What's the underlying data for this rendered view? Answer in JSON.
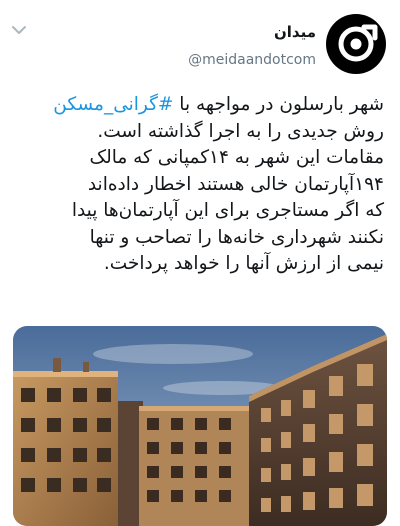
{
  "header": {
    "display_name": "میدان",
    "handle": "@meidaandotcom"
  },
  "tweet": {
    "line1_prefix": "شهر بارسلون در مواجهه با ",
    "hashtag": "#گرانی_مسکن",
    "line2": "روش جدیدی را به اجرا گذاشته است.",
    "line3": "مقامات این شهر به ۱۴کمپانی که مالک",
    "line4": "۱۹۴آپارتمان خالی هستند اخطار داده‌اند",
    "line5": "که اگر مستاجری برای این آپارتمان‌ها پیدا",
    "line6": "نکنند شهرداری خانه‌ها را تصاحب و تنها",
    "line7": "نیمی از ارزش آنها را خواهد پرداخت."
  },
  "colors": {
    "hashtag": "#1b95e0",
    "text": "#14171a",
    "muted": "#657786",
    "chevron": "#aab8c2"
  },
  "icons": {
    "chevron": "chevron-down-icon",
    "avatar_logo": "meidaan-logo-icon"
  },
  "media": {
    "description_name": "barcelona-apartment-buildings-photo"
  }
}
